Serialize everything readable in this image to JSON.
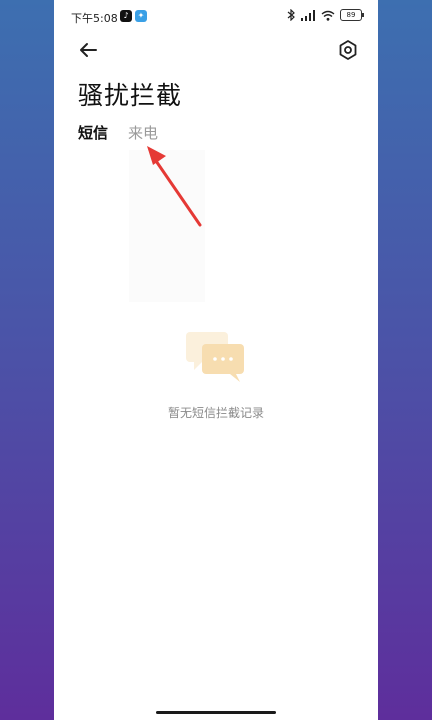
{
  "status_bar": {
    "time": "下午5:08",
    "battery": "89",
    "notification_icons": [
      "tiktok-icon",
      "app-icon"
    ],
    "system_icons": [
      "bluetooth-icon",
      "signal-icon",
      "wifi-icon",
      "battery-icon"
    ]
  },
  "header": {
    "title": "骚扰拦截",
    "back_icon": "arrow-left-icon",
    "settings_icon": "settings-icon"
  },
  "tabs": [
    {
      "label": "短信",
      "active": true
    },
    {
      "label": "来电",
      "active": false
    }
  ],
  "empty_state": {
    "icon": "message-bubbles-icon",
    "text": "暂无短信拦截记录"
  },
  "annotation": {
    "arrow_color": "#e53935"
  }
}
